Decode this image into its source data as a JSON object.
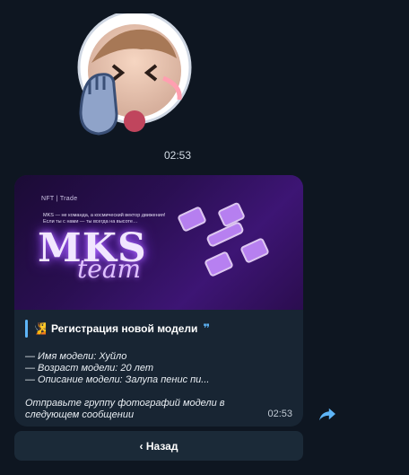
{
  "sticker": {
    "time": "02:53",
    "icon": "astronaut-facepalm-sticker"
  },
  "banner": {
    "top_labels": "NFT | Trade",
    "subtitle": "MKS — не команда, а космический вектор движения! Если ты с нами — ты всегда на высоте…",
    "title": "MKS",
    "team": "team"
  },
  "message": {
    "emoji": "🧏",
    "title": "Регистрация новой модели",
    "quote_icon": "quote-icon",
    "details": [
      "— Имя модели: Хуйло",
      "— Возраст модели: 20 лет",
      "— Описание модели: Залупа пенис пи..."
    ],
    "note": "Отправьте группу фотографий модели в следующем сообщении",
    "time": "02:53"
  },
  "actions": {
    "back_label": "‹ Назад"
  },
  "colors": {
    "background": "#0e1621",
    "bubble": "#182533",
    "accent": "#5eb5f7"
  }
}
